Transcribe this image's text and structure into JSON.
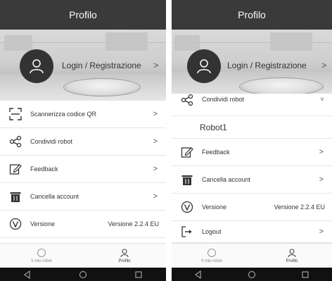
{
  "left": {
    "title": "Profilo",
    "login_label": "Login / Registrazione",
    "login_chevron": ">",
    "menu": [
      {
        "label": "Scannerizza codice QR",
        "chevron": ">"
      },
      {
        "label": "Condividi robot",
        "chevron": ">"
      },
      {
        "label": "Feedback",
        "chevron": ">"
      },
      {
        "label": "Cancella account",
        "chevron": ">"
      },
      {
        "label": "Versione",
        "value": "Versione 2.2.4 EU"
      }
    ],
    "nav": [
      {
        "label": "Il mio robot",
        "icon": "robot-icon"
      },
      {
        "label": "Profilo",
        "icon": "person-icon"
      }
    ]
  },
  "right": {
    "title": "Profilo",
    "login_label": "Login / Registrazione",
    "login_chevron": ">",
    "share_label": "Condividi robot",
    "share_chevron": "v",
    "robot_name": "Robot1",
    "menu": [
      {
        "label": "Feedback",
        "chevron": ">"
      },
      {
        "label": "Cancella account",
        "chevron": ">"
      },
      {
        "label": "Versione",
        "value": "Versione 2.2.4 EU"
      },
      {
        "label": "Logout",
        "chevron": ">"
      }
    ],
    "nav": [
      {
        "label": "Il mio robot",
        "icon": "robot-icon"
      },
      {
        "label": "Profilo",
        "icon": "person-icon"
      }
    ]
  },
  "system_nav": [
    "back-icon",
    "home-icon",
    "recents-icon"
  ],
  "colors": {
    "appbar": "#3a3a3a",
    "avatar": "#333333",
    "nav_bar": "#111111"
  }
}
